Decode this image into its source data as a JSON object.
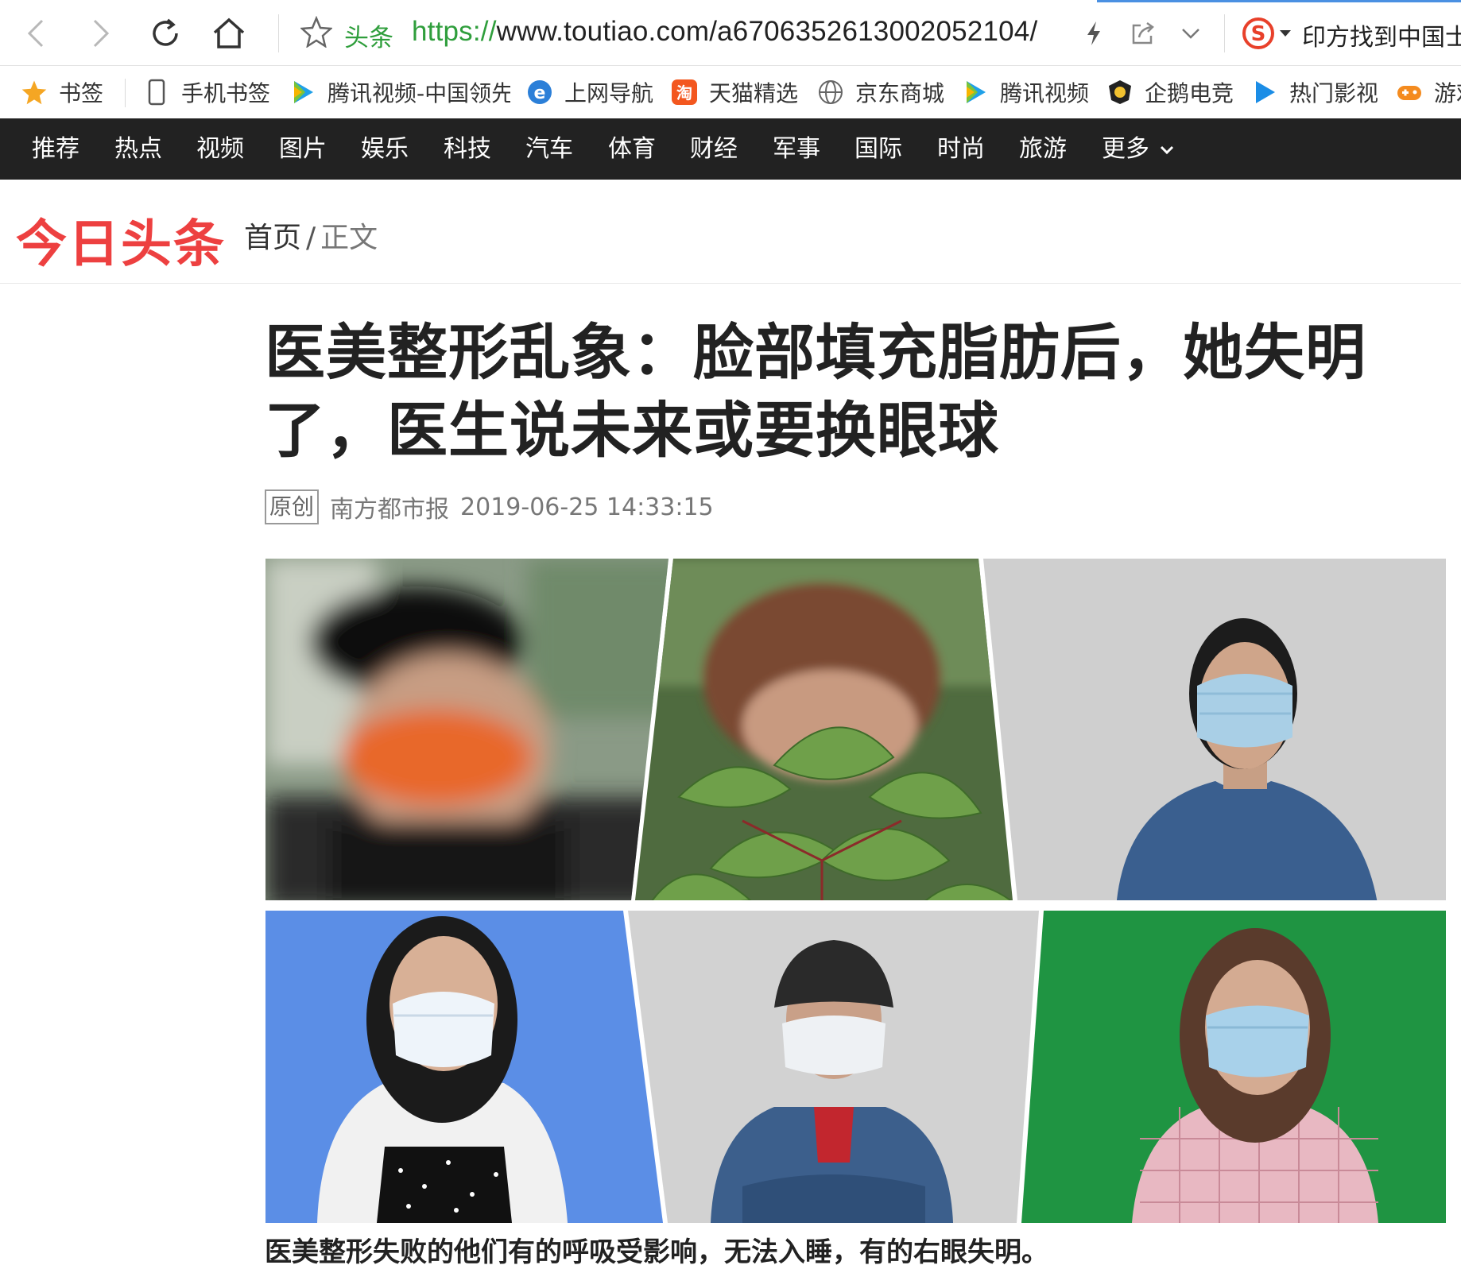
{
  "browser": {
    "site_label": "头条",
    "url_scheme": "https://",
    "url_rest": "www.toutiao.com/a6706352613002052104/",
    "search_text": "印方找到中国士"
  },
  "bookmarks": [
    {
      "label": "书签",
      "icon": "star-icon"
    },
    {
      "label": "手机书签",
      "icon": "phone-icon"
    },
    {
      "label": "腾讯视频-中国领先",
      "icon": "tencent-video-icon"
    },
    {
      "label": "上网导航",
      "icon": "ie-icon"
    },
    {
      "label": "天猫精选",
      "icon": "taobao-icon"
    },
    {
      "label": "京东商城",
      "icon": "globe-icon"
    },
    {
      "label": "腾讯视频",
      "icon": "tencent-video-icon"
    },
    {
      "label": "企鹅电竞",
      "icon": "penguin-esports-icon"
    },
    {
      "label": "热门影视",
      "icon": "play-icon"
    },
    {
      "label": "游戏",
      "icon": "gamepad-icon"
    }
  ],
  "channels": [
    "推荐",
    "热点",
    "视频",
    "图片",
    "娱乐",
    "科技",
    "汽车",
    "体育",
    "财经",
    "军事",
    "国际",
    "时尚",
    "旅游",
    "更多"
  ],
  "site": {
    "logo": "今日头条",
    "breadcrumb_home": "首页",
    "breadcrumb_sep": "/",
    "breadcrumb_current": "正文"
  },
  "article": {
    "title": "医美整形乱象：脸部填充脂肪后，她失明了，医生说未来或要换眼球",
    "badge": "原创",
    "source": "南方都市报",
    "datetime": "2019-06-25 14:33:15",
    "caption": "医美整形失败的他们有的呼吸受影响，无法入睡，有的右眼失明。"
  },
  "colors": {
    "channel_bar": "#222222",
    "logo_red": "#ed4040",
    "url_green": "#2f9e3c"
  }
}
